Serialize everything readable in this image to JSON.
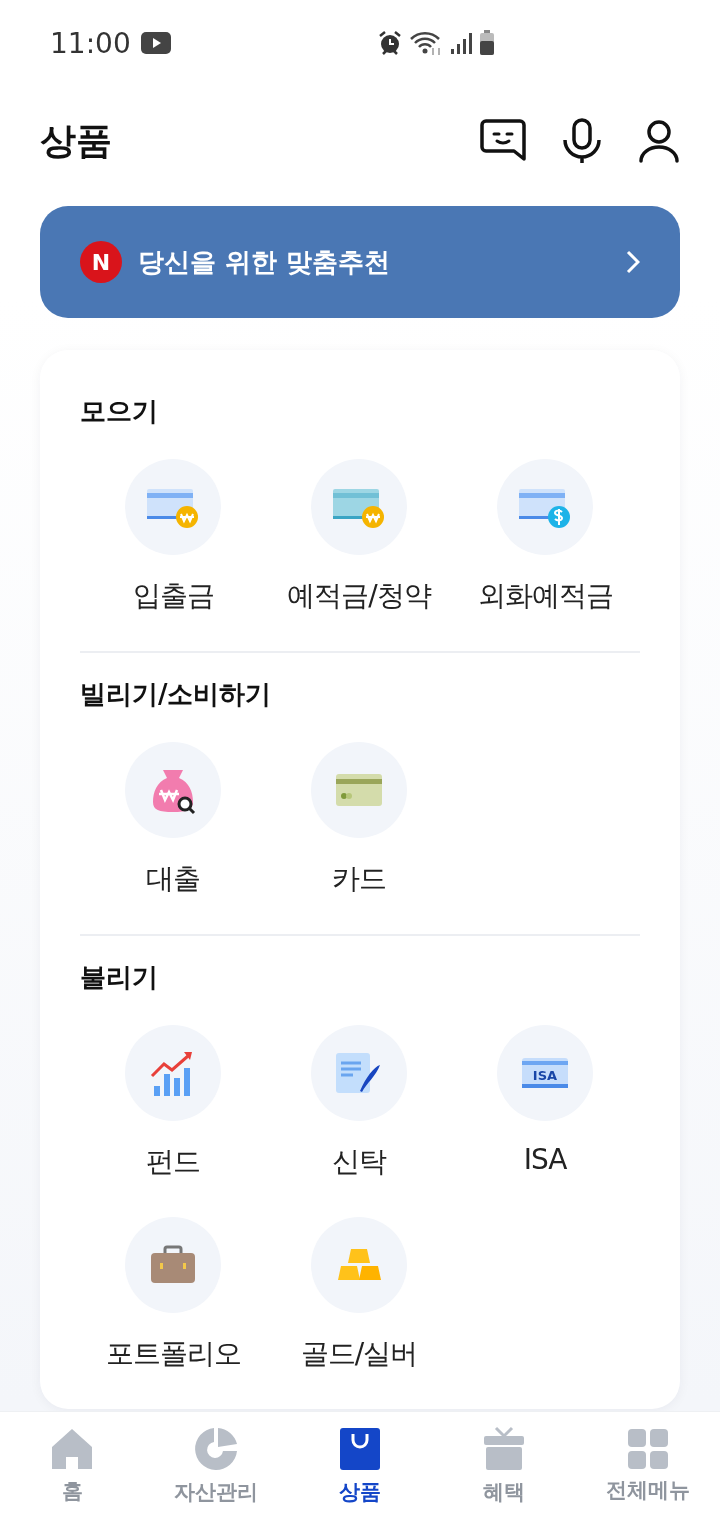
{
  "status_bar": {
    "time": "11:00"
  },
  "header": {
    "title": "상품"
  },
  "banner": {
    "badge": "N",
    "text": "당신을 위한 맞춤추천"
  },
  "sections": [
    {
      "title": "모으기",
      "items": [
        {
          "label": "입출금",
          "kind": "deposit"
        },
        {
          "label": "예적금/청약",
          "kind": "savings"
        },
        {
          "label": "외화예적금",
          "kind": "foreign"
        }
      ]
    },
    {
      "title": "빌리기/소비하기",
      "items": [
        {
          "label": "대출",
          "kind": "loan"
        },
        {
          "label": "카드",
          "kind": "card"
        }
      ]
    },
    {
      "title": "불리기",
      "items": [
        {
          "label": "펀드",
          "kind": "fund"
        },
        {
          "label": "신탁",
          "kind": "trust"
        },
        {
          "label": "ISA",
          "kind": "isa",
          "icon_text": "ISA"
        },
        {
          "label": "포트폴리오",
          "kind": "portfolio"
        },
        {
          "label": "골드/실버",
          "kind": "bullion"
        }
      ]
    }
  ],
  "bottom_nav": [
    {
      "label": "홈",
      "kind": "home",
      "selected": false
    },
    {
      "label": "자산관리",
      "kind": "assets",
      "selected": false
    },
    {
      "label": "상품",
      "kind": "products",
      "selected": true
    },
    {
      "label": "혜택",
      "kind": "benefits",
      "selected": false
    },
    {
      "label": "전체메뉴",
      "kind": "menu",
      "selected": false
    }
  ]
}
